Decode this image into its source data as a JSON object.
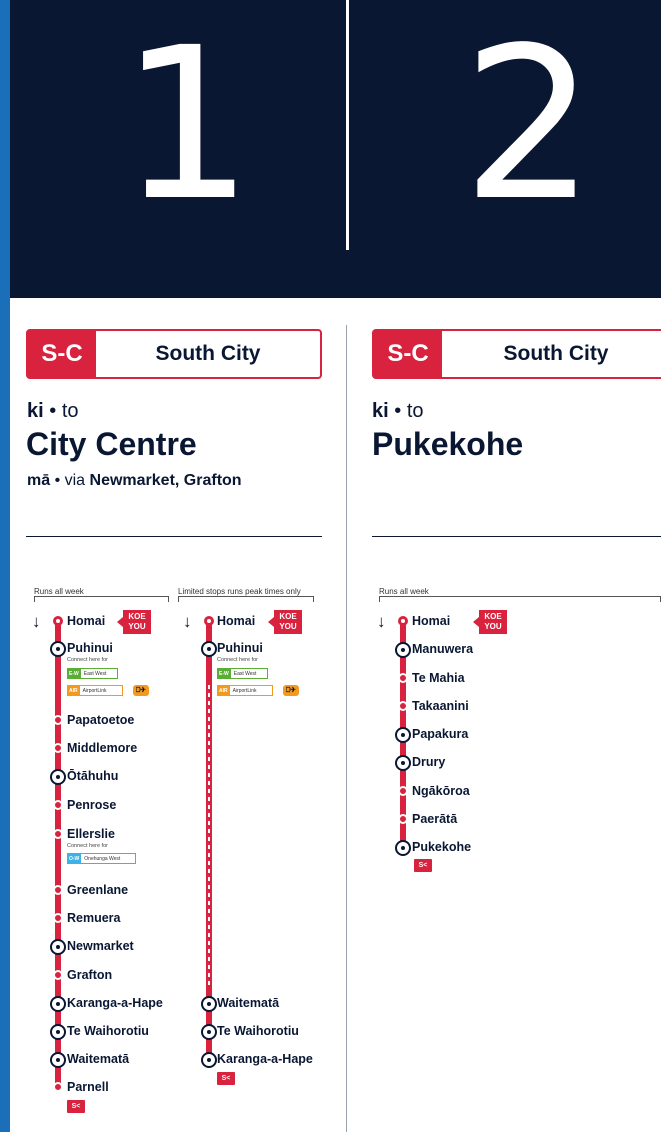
{
  "platforms": [
    "1",
    "2"
  ],
  "colors": {
    "navy": "#0a1733",
    "route_red": "#d8223e",
    "frame_blue": "#1b6fb8",
    "eastwest_green": "#5aad35",
    "airport_orange": "#f39a1e",
    "onehunga_blue": "#3eb1e5"
  },
  "left": {
    "code": "S-C",
    "line_name": "South City",
    "ki": "ki",
    "to": "to",
    "destination": "City Centre",
    "ma": "mā",
    "via_word": "via",
    "via_places": "Newmarket, Grafton",
    "bracket_all": "Runs all week",
    "bracket_limited": "Limited stops runs peak times only",
    "koe": [
      "KOE",
      "YOU"
    ],
    "connect": "Connect here for",
    "ew_code": "E-W",
    "ew_text": "East West",
    "air_code": "AIR",
    "air_text": "AirportLink",
    "bus_plane": "⎕✈",
    "onehunga_code": "O-W",
    "onehunga_text": "Onehunga West",
    "stops_all": [
      "Homai",
      "Puhinui",
      "Papatoetoe",
      "Middlemore",
      "Ōtāhuhu",
      "Penrose",
      "Ellerslie",
      "Greenlane",
      "Remuera",
      "Newmarket",
      "Grafton",
      "Karanga-a-Hape",
      "Te Waihorotiu",
      "Waitematā",
      "Parnell"
    ],
    "stops_limited": [
      "Homai",
      "Puhinui",
      "Waitematā",
      "Te Waihorotiu",
      "Karanga-a-Hape"
    ],
    "end_code": "S<"
  },
  "right": {
    "code": "S-C",
    "line_name": "South City",
    "ki": "ki",
    "to": "to",
    "destination": "Pukekohe",
    "bracket_all": "Runs all week",
    "koe": [
      "KOE",
      "YOU"
    ],
    "stops": [
      "Homai",
      "Manuwera",
      "Te Mahia",
      "Takaanini",
      "Papakura",
      "Drury",
      "Ngākōroa",
      "Paerātā",
      "Pukekohe"
    ],
    "end_code": "S<"
  }
}
